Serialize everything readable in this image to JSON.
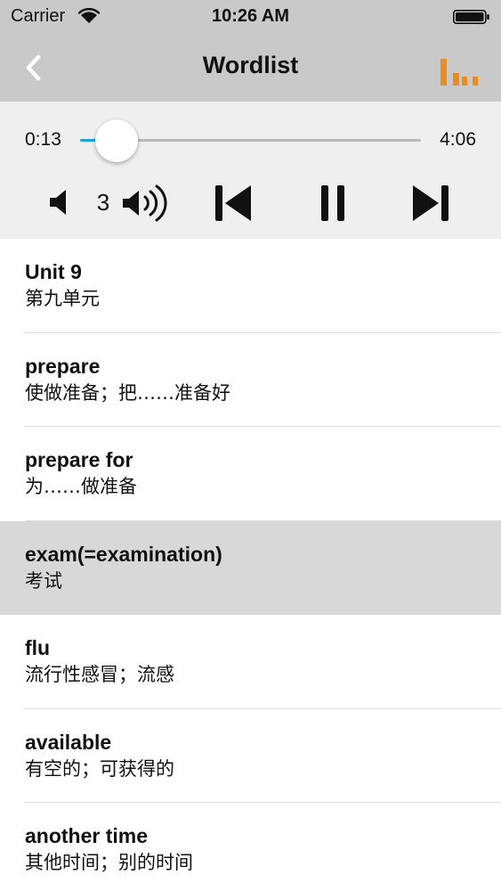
{
  "status_bar": {
    "carrier": "Carrier",
    "time": "10:26 AM"
  },
  "nav": {
    "title": "Wordlist",
    "back_icon": "chevron-left-icon",
    "levels_icon": "bar-levels-icon"
  },
  "player": {
    "elapsed": "0:13",
    "total": "4:06",
    "progress": 0.053,
    "volume": "3",
    "accent_color": "#1aa4e0"
  },
  "colors": {
    "nav_background": "#c9c9c9",
    "player_background": "#efefef",
    "highlight": "#d8d8d8",
    "orange_icon": "#f08a1c"
  },
  "words": [
    {
      "word": "Unit 9",
      "meaning": "第九单元",
      "highlighted": false
    },
    {
      "word": "prepare",
      "meaning": "使做准备；把……准备好",
      "highlighted": false
    },
    {
      "word": "prepare for",
      "meaning": "为……做准备",
      "highlighted": false
    },
    {
      "word": "exam(=examination)",
      "meaning": "考试",
      "highlighted": true
    },
    {
      "word": "flu",
      "meaning": "流行性感冒；流感",
      "highlighted": false
    },
    {
      "word": "available",
      "meaning": "有空的；可获得的",
      "highlighted": false
    },
    {
      "word": "another time",
      "meaning": "其他时间；别的时间",
      "highlighted": false
    }
  ]
}
